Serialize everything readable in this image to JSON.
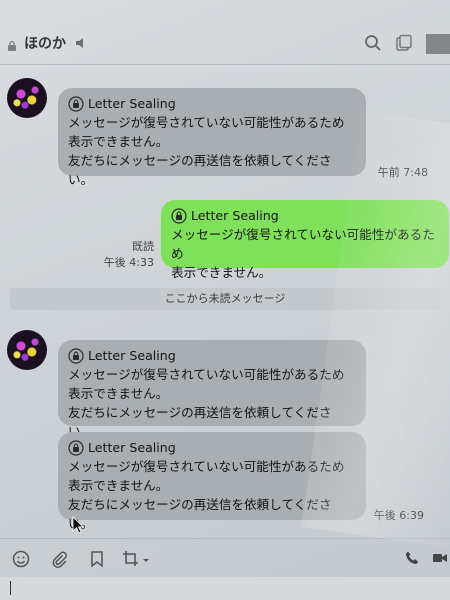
{
  "header": {
    "title": "ほのか"
  },
  "messages": [
    {
      "sender": "ほのか",
      "label": "Letter Sealing",
      "lines": [
        "メッセージが復号されていない可能性があるため",
        "表示できません。",
        "友だちにメッセージの再送信を依頼してください。"
      ],
      "time": "午前 7:48"
    },
    {
      "sender": "me",
      "label": "Letter Sealing",
      "lines": [
        "メッセージが復号されていない可能性があるため",
        "表示できません。"
      ],
      "read": "既読",
      "time": "午後 4:33"
    },
    {
      "sender": "ほのか",
      "label": "Letter Sealing",
      "lines": [
        "メッセージが復号されていない可能性があるため",
        "表示できません。",
        "友だちにメッセージの再送信を依頼してください。"
      ]
    },
    {
      "sender": "ほのか",
      "label": "Letter Sealing",
      "lines": [
        "メッセージが復号されていない可能性があるため",
        "表示できません。",
        "友だちにメッセージの再送信を依頼してください。"
      ],
      "time": "午後 6:39"
    }
  ],
  "divider": {
    "label": "ここから未読メッセージ"
  },
  "icons": {
    "header": [
      "lock-icon",
      "speaker-icon",
      "search-icon",
      "notes-icon"
    ],
    "toolbar": [
      "emoji-icon",
      "attach-icon",
      "bookmark-icon",
      "crop-icon",
      "call-icon",
      "video-icon"
    ]
  },
  "colors": {
    "incoming_bubble": "#a9aeb2",
    "outgoing_bubble": "#7fe05a",
    "background": "#cfd4d8"
  }
}
